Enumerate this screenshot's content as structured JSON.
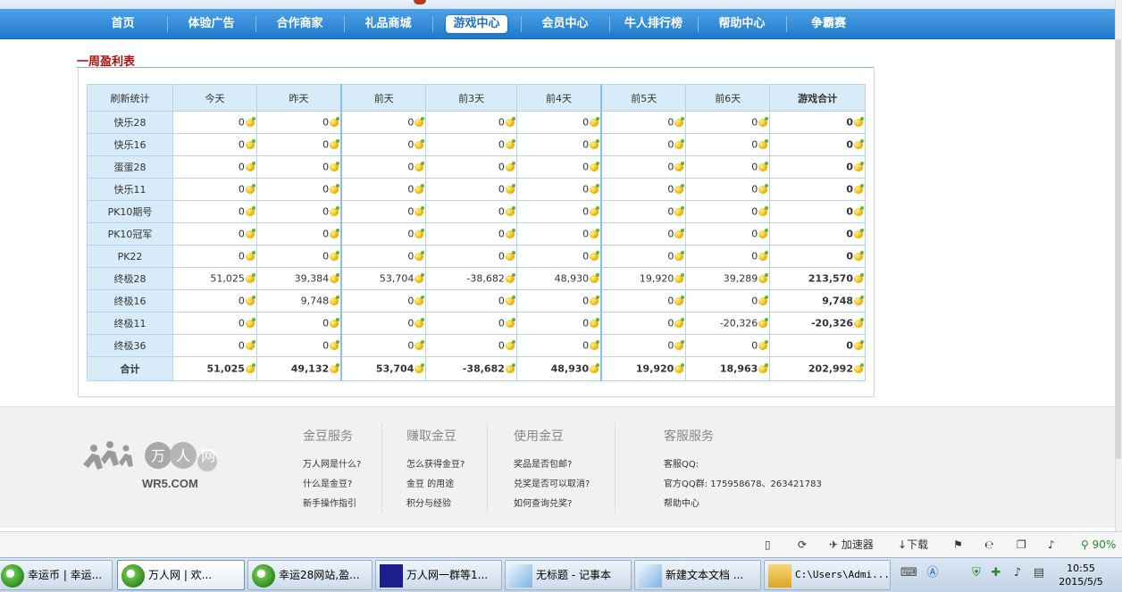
{
  "nav": {
    "items": [
      {
        "label": "首页"
      },
      {
        "label": "体验广告"
      },
      {
        "label": "合作商家"
      },
      {
        "label": "礼品商城"
      },
      {
        "label": "游戏中心",
        "active": true
      },
      {
        "label": "会员中心"
      },
      {
        "label": "牛人排行榜"
      },
      {
        "label": "帮助中心"
      },
      {
        "label": "争霸赛"
      }
    ]
  },
  "section": {
    "title": "一周盈利表"
  },
  "table": {
    "headers": [
      "刷新统计",
      "今天",
      "昨天",
      "前天",
      "前3天",
      "前4天",
      "前5天",
      "前6天",
      "游戏合计"
    ],
    "rows": [
      {
        "label": "快乐28",
        "values": [
          "0",
          "0",
          "0",
          "0",
          "0",
          "0",
          "0",
          "0"
        ]
      },
      {
        "label": "快乐16",
        "values": [
          "0",
          "0",
          "0",
          "0",
          "0",
          "0",
          "0",
          "0"
        ]
      },
      {
        "label": "蛋蛋28",
        "values": [
          "0",
          "0",
          "0",
          "0",
          "0",
          "0",
          "0",
          "0"
        ]
      },
      {
        "label": "快乐11",
        "values": [
          "0",
          "0",
          "0",
          "0",
          "0",
          "0",
          "0",
          "0"
        ]
      },
      {
        "label": "PK10期号",
        "values": [
          "0",
          "0",
          "0",
          "0",
          "0",
          "0",
          "0",
          "0"
        ]
      },
      {
        "label": "PK10冠军",
        "values": [
          "0",
          "0",
          "0",
          "0",
          "0",
          "0",
          "0",
          "0"
        ]
      },
      {
        "label": "PK22",
        "values": [
          "0",
          "0",
          "0",
          "0",
          "0",
          "0",
          "0",
          "0"
        ]
      },
      {
        "label": "终极28",
        "values": [
          "51,025",
          "39,384",
          "53,704",
          "-38,682",
          "48,930",
          "19,920",
          "39,289",
          "213,570"
        ]
      },
      {
        "label": "终极16",
        "values": [
          "0",
          "9,748",
          "0",
          "0",
          "0",
          "0",
          "0",
          "9,748"
        ]
      },
      {
        "label": "终极11",
        "values": [
          "0",
          "0",
          "0",
          "0",
          "0",
          "0",
          "-20,326",
          "-20,326"
        ]
      },
      {
        "label": "终极36",
        "values": [
          "0",
          "0",
          "0",
          "0",
          "0",
          "0",
          "0",
          "0"
        ]
      }
    ],
    "total": {
      "label": "合计",
      "values": [
        "51,025",
        "49,132",
        "53,704",
        "-38,682",
        "48,930",
        "19,920",
        "18,963",
        "202,992"
      ]
    }
  },
  "footer": {
    "logo_text": "万人网",
    "logo_domain": "WR5.COM",
    "columns": [
      {
        "heading": "金豆服务",
        "links": [
          "万人网是什么?",
          "什么是金豆?",
          "新手操作指引"
        ]
      },
      {
        "heading": "赚取金豆",
        "links": [
          "怎么获得金豆?",
          "金豆 的用途",
          "积分与经验"
        ]
      },
      {
        "heading": "使用金豆",
        "links": [
          "奖品是否包邮?",
          "兑奖是否可以取消?",
          "如何查询兑奖?"
        ]
      },
      {
        "heading": "客服服务",
        "links": [
          "客服QQ:",
          "官方QQ群: 175958678、263421783",
          "帮助中心"
        ]
      }
    ]
  },
  "statusbar": {
    "accelerator": "加速器",
    "download": "下载",
    "zoom": "90%"
  },
  "taskbar": {
    "tasks": [
      {
        "label": "幸运币 | 幸运..."
      },
      {
        "label": "万人网 | 欢..."
      },
      {
        "label": "幸运28网站,盈..."
      },
      {
        "label": "万人网一群等1..."
      },
      {
        "label": "无标题 - 记事本"
      },
      {
        "label": "新建文本文档 ..."
      },
      {
        "label": "C:\\Users\\Admi..."
      }
    ],
    "clock_time": "10:55",
    "clock_date": "2015/5/5"
  }
}
